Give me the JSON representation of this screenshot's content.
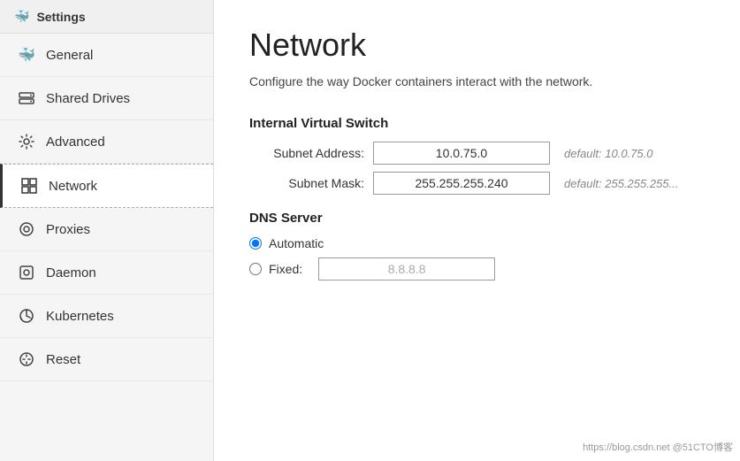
{
  "app": {
    "title": "Settings"
  },
  "sidebar": {
    "items": [
      {
        "id": "general",
        "label": "General",
        "icon": "🐳",
        "active": false
      },
      {
        "id": "shared-drives",
        "label": "Shared Drives",
        "icon": "🖥",
        "active": false
      },
      {
        "id": "advanced",
        "label": "Advanced",
        "icon": "⚙",
        "active": false
      },
      {
        "id": "network",
        "label": "Network",
        "icon": "⊞",
        "active": true
      },
      {
        "id": "proxies",
        "label": "Proxies",
        "icon": "◎",
        "active": false
      },
      {
        "id": "daemon",
        "label": "Daemon",
        "icon": "◉",
        "active": false
      },
      {
        "id": "kubernetes",
        "label": "Kubernetes",
        "icon": "⚙",
        "active": false
      },
      {
        "id": "reset",
        "label": "Reset",
        "icon": "⏻",
        "active": false
      }
    ]
  },
  "main": {
    "title": "Network",
    "description": "Configure the way Docker containers interact with the network.",
    "internal_virtual_switch": {
      "heading": "Internal Virtual Switch",
      "subnet_address_label": "Subnet Address:",
      "subnet_address_value": "10.0.75.0",
      "subnet_address_default": "default: 10.0.75.0",
      "subnet_mask_label": "Subnet Mask:",
      "subnet_mask_value": "255.255.255.240",
      "subnet_mask_default": "default: 255.255.255..."
    },
    "dns_server": {
      "heading": "DNS Server",
      "automatic_label": "Automatic",
      "fixed_label": "Fixed:",
      "fixed_value": "8.8.8.8"
    }
  },
  "watermark": "https://blog.csdn.net @51CTO博客"
}
